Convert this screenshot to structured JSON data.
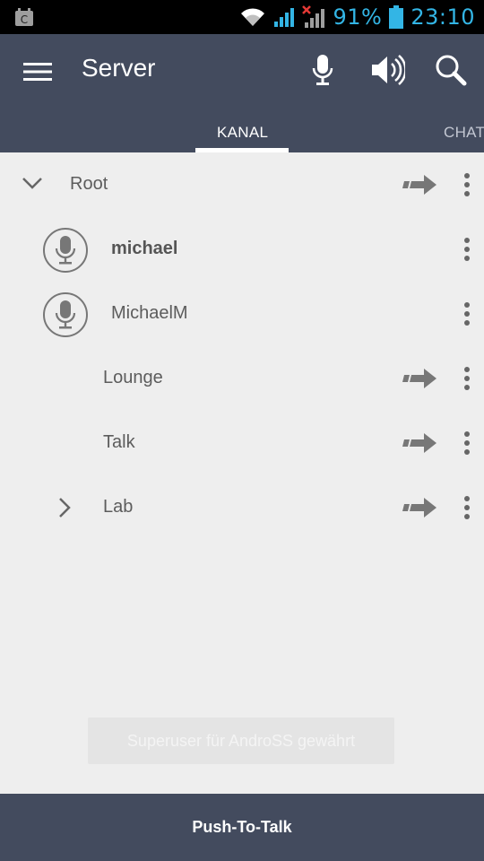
{
  "status_bar": {
    "battery_percent": "91%",
    "time": "23:10",
    "icons": [
      "app-notification-icon",
      "wifi-icon",
      "signal-icon",
      "signal-no-service-icon",
      "battery-icon"
    ],
    "accent": "#33b5e5"
  },
  "app_bar": {
    "title": "Server",
    "icons": [
      "menu-icon",
      "microphone-icon",
      "speaker-icon",
      "search-icon"
    ],
    "color": "#434b5e"
  },
  "tabs": [
    {
      "label": "KANAL",
      "active": true
    },
    {
      "label": "CHAT",
      "active": false
    }
  ],
  "channel_list": [
    {
      "type": "channel",
      "label": "Root",
      "expanded": true
    },
    {
      "type": "user",
      "label": "michael",
      "bold": true
    },
    {
      "type": "user",
      "label": "MichaelM",
      "bold": false
    },
    {
      "type": "channel",
      "label": "Lounge"
    },
    {
      "type": "channel",
      "label": "Talk"
    },
    {
      "type": "channel",
      "label": "Lab",
      "expanded": false
    }
  ],
  "toast": {
    "text": "Superuser für AndroSS gewährt"
  },
  "push_to_talk": {
    "label": "Push-To-Talk"
  }
}
